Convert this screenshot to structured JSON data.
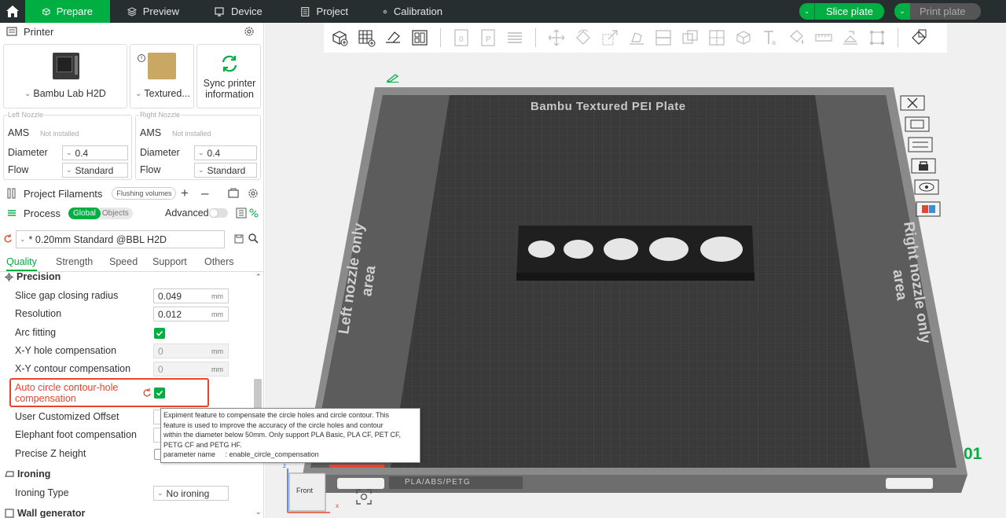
{
  "topbar": {
    "tabs": [
      {
        "label": "Prepare",
        "icon": "cube-icon",
        "active": true
      },
      {
        "label": "Preview",
        "icon": "layers-icon",
        "active": false
      },
      {
        "label": "Device",
        "icon": "device-icon",
        "active": false
      },
      {
        "label": "Project",
        "icon": "project-icon",
        "active": false
      },
      {
        "label": "Calibration",
        "icon": "calibration-icon",
        "active": false
      }
    ],
    "slice_label": "Slice plate",
    "print_label": "Print plate"
  },
  "printer": {
    "header": "Printer",
    "printer_name": "Bambu Lab H2D",
    "plate_name": "Textured...",
    "sync_label": "Sync printer information",
    "left_nozzle": {
      "title": "Left Nozzle",
      "ams_label": "AMS",
      "ams_status": "Not installed",
      "diameter_label": "Diameter",
      "diameter_value": "0.4",
      "flow_label": "Flow",
      "flow_value": "Standard"
    },
    "right_nozzle": {
      "title": "Right Nozzle",
      "ams_label": "AMS",
      "ams_status": "Not installed",
      "diameter_label": "Diameter",
      "diameter_value": "0.4",
      "flow_label": "Flow",
      "flow_value": "Standard"
    }
  },
  "filaments": {
    "label": "Project Filaments",
    "flushing_label": "Flushing volumes"
  },
  "process": {
    "label": "Process",
    "global_label": "Global",
    "objects_label": "Objects",
    "advanced_label": "Advanced",
    "preset": "* 0.20mm Standard @BBL H2D",
    "tabs": [
      "Quality",
      "Strength",
      "Speed",
      "Support",
      "Others"
    ]
  },
  "params": {
    "precision_header": "Precision",
    "slice_gap_label": "Slice gap closing radius",
    "slice_gap_value": "0.049",
    "resolution_label": "Resolution",
    "resolution_value": "0.012",
    "arc_label": "Arc fitting",
    "xy_hole_label": "X-Y hole compensation",
    "xy_hole_value": "0",
    "xy_contour_label": "X-Y contour compensation",
    "xy_contour_value": "0",
    "auto_circle_label_1": "Auto circle contour-hole",
    "auto_circle_label_2": "compensation",
    "user_offset_label": "User Customized Offset",
    "elephant_label": "Elephant foot compensation",
    "precise_z_label": "Precise Z height",
    "ironing_header": "Ironing",
    "ironing_type_label": "Ironing Type",
    "ironing_type_value": "No ironing",
    "wall_header": "Wall generator",
    "unit": "mm"
  },
  "tooltip": {
    "lines": [
      "Expiment feature to compensate the circle holes and circle contour. This",
      "feature is used to improve the accuracy of the circle holes and contour",
      "within the diameter below 50mm. Only support PLA Basic, PLA CF, PET CF,",
      "PETG CF and PETG HF.",
      "parameter name     : enable_circle_compensation"
    ]
  },
  "viewport": {
    "plate_title": "Bambu Textured PEI Plate",
    "left_area": "Left nozzle only area",
    "right_area": "Right nozzle only area",
    "plate_number": "01",
    "plate_badge": "PLA/ABS/PETG",
    "view_cube_label": "Front",
    "axis_z": "z",
    "axis_x": "x"
  },
  "colors": {
    "accent": "#00ae42",
    "topbar": "#262e30",
    "highlight": "#e8452c"
  }
}
